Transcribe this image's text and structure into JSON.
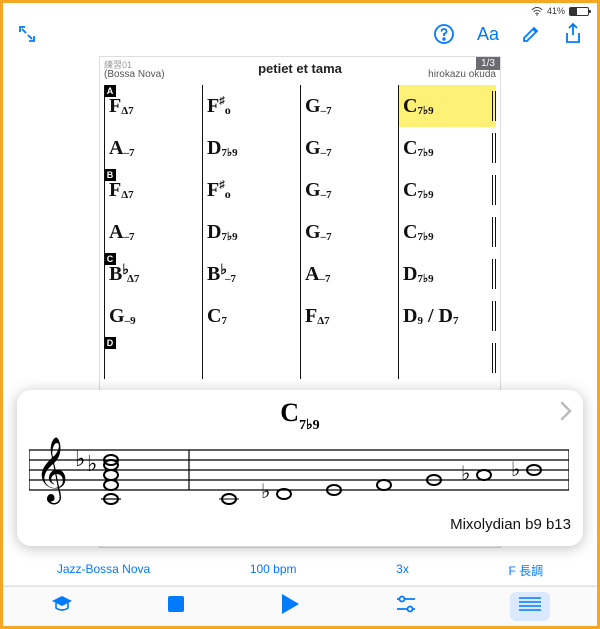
{
  "status": {
    "battery_pct": "41%",
    "wifi": true
  },
  "doc": {
    "file_label": "練習01",
    "style": "(Bossa Nova)",
    "title": "petiet et tama",
    "author": "hirokazu okuda",
    "page_badge": "1/3"
  },
  "sections": [
    "A",
    "B",
    "C",
    "D"
  ],
  "rows": [
    {
      "section": "A",
      "cells": [
        {
          "root": "F",
          "suf": "Δ7"
        },
        {
          "root": "F",
          "acc": "♯",
          "suf": "o",
          "sup": true
        },
        {
          "root": "G",
          "suf": "–7"
        },
        {
          "root": "C",
          "suf": "7♭9",
          "hl": true
        }
      ]
    },
    {
      "cells": [
        {
          "root": "A",
          "suf": "–7"
        },
        {
          "root": "D",
          "suf": "7♭9"
        },
        {
          "root": "G",
          "suf": "–7"
        },
        {
          "root": "C",
          "suf": "7♭9"
        }
      ]
    },
    {
      "section": "B",
      "cells": [
        {
          "root": "F",
          "suf": "Δ7"
        },
        {
          "root": "F",
          "acc": "♯",
          "suf": "o",
          "sup": true
        },
        {
          "root": "G",
          "suf": "–7"
        },
        {
          "root": "C",
          "suf": "7♭9"
        }
      ]
    },
    {
      "cells": [
        {
          "root": "A",
          "suf": "–7"
        },
        {
          "root": "D",
          "suf": "7♭9"
        },
        {
          "root": "G",
          "suf": "–7"
        },
        {
          "root": "C",
          "suf": "7♭9"
        }
      ]
    },
    {
      "section": "C",
      "cells": [
        {
          "root": "B",
          "acc": "♭",
          "suf": "Δ7"
        },
        {
          "root": "B",
          "acc": "♭",
          "suf": "–7"
        },
        {
          "root": "A",
          "suf": "–7"
        },
        {
          "root": "D",
          "suf": "7♭9"
        }
      ]
    },
    {
      "cells": [
        {
          "root": "G",
          "suf": "–9"
        },
        {
          "root": "C",
          "suf": "7"
        },
        {
          "root": "F",
          "suf": "Δ7"
        },
        {
          "root": "D",
          "suf": "9",
          "slash": "D7"
        }
      ]
    },
    {
      "section": "D",
      "cells": [
        {
          "root": " "
        },
        {
          "root": " "
        },
        {
          "root": " "
        },
        {
          "root": " "
        }
      ]
    }
  ],
  "voicing": {
    "chord_display": "C7♭9",
    "scale_name": "Mixolydian b9 b13"
  },
  "playback": {
    "style": "Jazz-Bossa Nova",
    "tempo": "100 bpm",
    "repeats": "3x",
    "key": "F 長調"
  },
  "icons": {
    "expand": "expand",
    "help": "?",
    "font": "Aa",
    "edit": "pencil",
    "share": "share",
    "hat": "graduation",
    "stop": "stop",
    "play": "play",
    "sliders": "sliders",
    "staff": "staff"
  }
}
